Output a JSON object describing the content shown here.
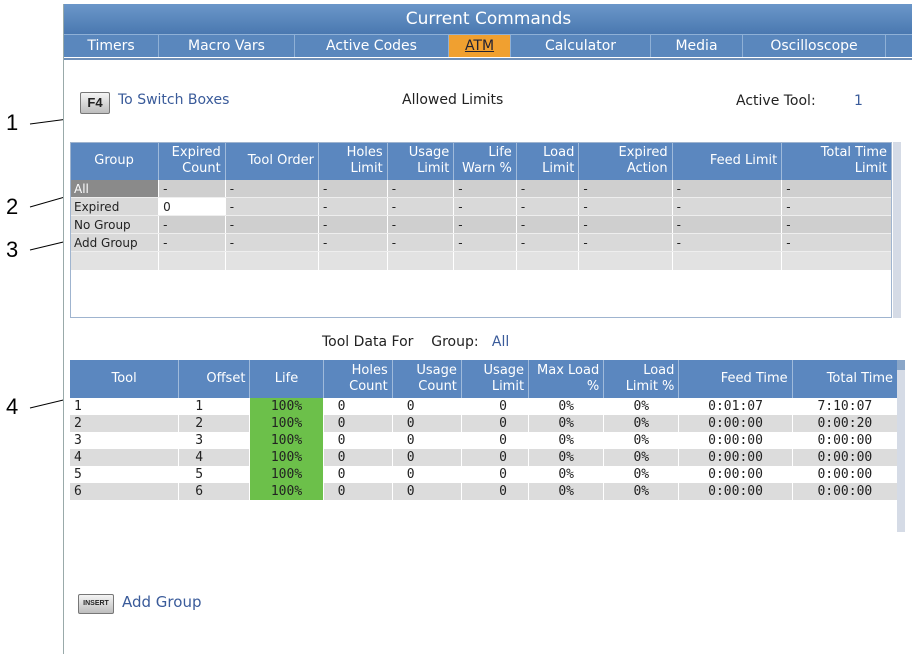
{
  "callouts": [
    "1",
    "2",
    "3",
    "4"
  ],
  "window": {
    "title": "Current Commands",
    "tabs": [
      "Timers",
      "Macro Vars",
      "Active Codes",
      "ATM",
      "Calculator",
      "Media",
      "Oscilloscope"
    ],
    "active_tab": "ATM"
  },
  "header": {
    "f4_key": "F4",
    "switch_text": "To Switch Boxes",
    "allowed_title": "Allowed Limits",
    "active_tool_label": "Active Tool:",
    "active_tool_value": "1"
  },
  "limits_table": {
    "columns": [
      "Group",
      "Expired Count",
      "Tool Order",
      "Holes Limit",
      "Usage Limit",
      "Life Warn %",
      "Load Limit",
      "Expired Action",
      "Feed Limit",
      "Total Time Limit"
    ],
    "rows": [
      [
        "All",
        "-",
        "-",
        "-",
        "-",
        "-",
        "-",
        "-",
        "-",
        "-"
      ],
      [
        "Expired",
        "0",
        "-",
        "-",
        "-",
        "-",
        "-",
        "-",
        "-",
        "-"
      ],
      [
        "No Group",
        "-",
        "-",
        "-",
        "-",
        "-",
        "-",
        "-",
        "-",
        "-"
      ],
      [
        "Add Group",
        "-",
        "-",
        "-",
        "-",
        "-",
        "-",
        "-",
        "-",
        "-"
      ]
    ]
  },
  "tool_data": {
    "title": "Tool Data For",
    "group_label": "Group:",
    "group_value": "All"
  },
  "tools_table": {
    "columns": [
      "Tool",
      "Offset",
      "Life",
      "Holes Count",
      "Usage Count",
      "Usage Limit",
      "Max Load %",
      "Load Limit %",
      "Feed Time",
      "Total Time"
    ],
    "rows": [
      [
        "1",
        "1",
        "100%",
        "0",
        "0",
        "0",
        "0%",
        "0%",
        "0:01:07",
        "7:10:07"
      ],
      [
        "2",
        "2",
        "100%",
        "0",
        "0",
        "0",
        "0%",
        "0%",
        "0:00:00",
        "0:00:20"
      ],
      [
        "3",
        "3",
        "100%",
        "0",
        "0",
        "0",
        "0%",
        "0%",
        "0:00:00",
        "0:00:00"
      ],
      [
        "4",
        "4",
        "100%",
        "0",
        "0",
        "0",
        "0%",
        "0%",
        "0:00:00",
        "0:00:00"
      ],
      [
        "5",
        "5",
        "100%",
        "0",
        "0",
        "0",
        "0%",
        "0%",
        "0:00:00",
        "0:00:00"
      ],
      [
        "6",
        "6",
        "100%",
        "0",
        "0",
        "0",
        "0%",
        "0%",
        "0:00:00",
        "0:00:00"
      ]
    ]
  },
  "footer": {
    "insert_key": "INSERT",
    "add_group": "Add Group"
  },
  "colors": {
    "title_bar": "#5a87bd",
    "active_tab": "#f0a030",
    "life_cell": "#6cc04a",
    "link_text": "#3a5b9a"
  }
}
